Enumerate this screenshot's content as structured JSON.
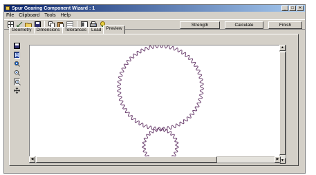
{
  "window": {
    "title": "Spur Gearing Component Wizard : 1"
  },
  "window_controls": {
    "minimize": "_",
    "maximize": "□",
    "close": "✕"
  },
  "menu": [
    "File",
    "Clipboard",
    "Tools",
    "Help"
  ],
  "toolbar_icons": [
    "grid-icon",
    "dimension-icon",
    "open-folder-icon",
    "save-icon",
    "copy-icon",
    "paste-icon",
    "table-icon",
    "layout-icon",
    "print-icon",
    "help-icon"
  ],
  "buttons": {
    "strength": "Strength",
    "calculate": "Calculate",
    "finish": "Finish"
  },
  "tabs": [
    "Geometry",
    "Dimensions",
    "Tolerances",
    "Load",
    "Preview"
  ],
  "active_tab": "Preview",
  "side_tools": [
    "save-icon",
    "fit-view-icon",
    "zoom-window-icon",
    "zoom-in-icon",
    "zoom-out-icon",
    "pan-icon"
  ],
  "preview": {
    "gear1_teeth": 58,
    "gear2_teeth": 25,
    "gear_color": "#6b3f6e"
  }
}
